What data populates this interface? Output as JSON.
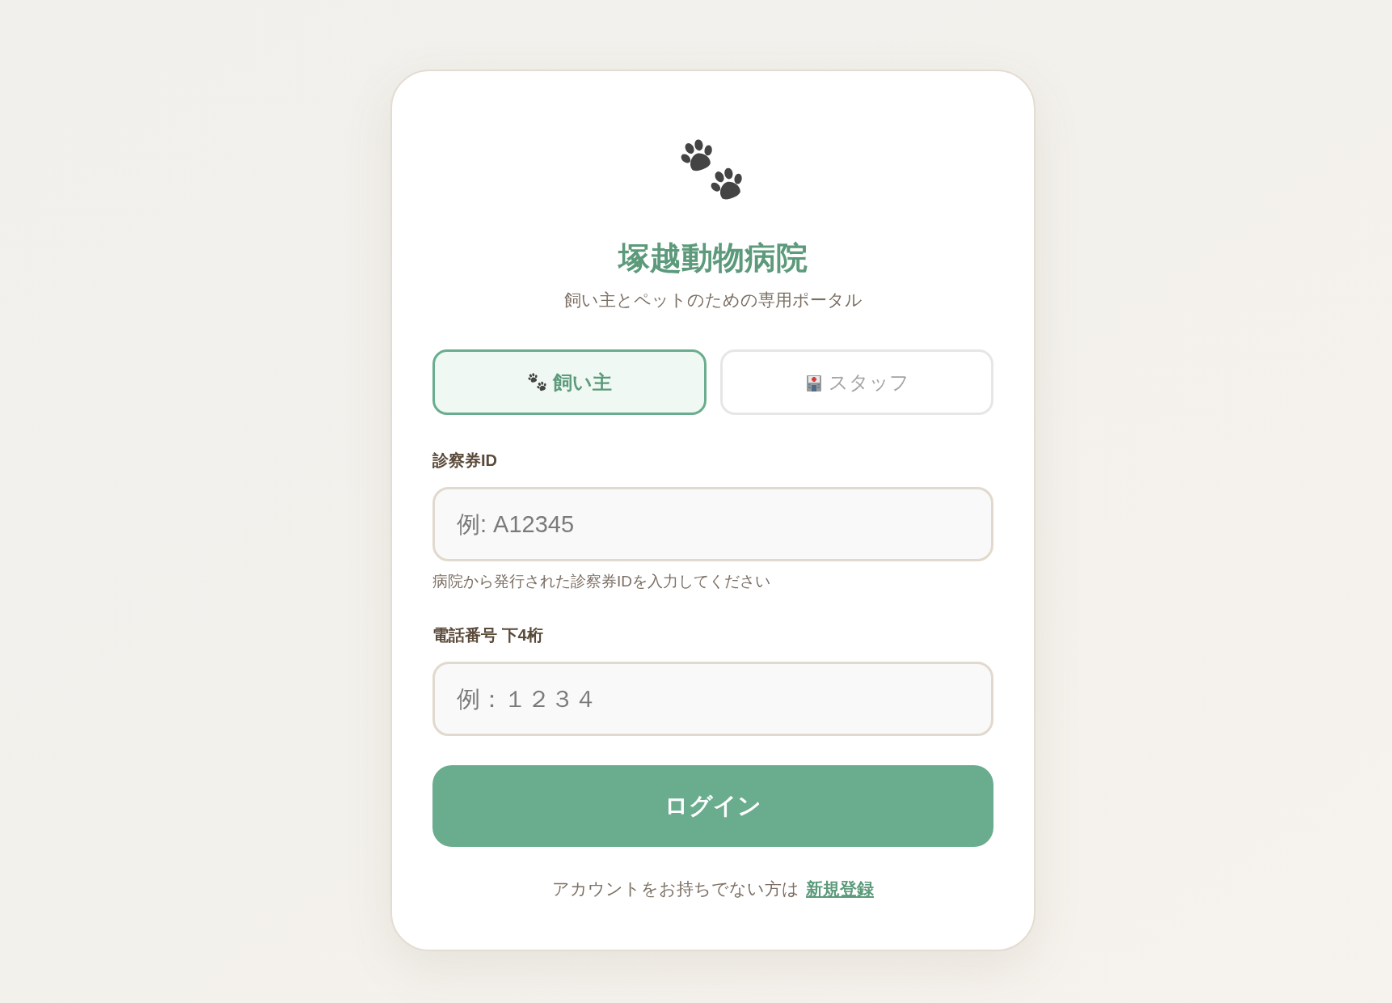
{
  "header": {
    "title": "塚越動物病院",
    "subtitle": "飼い主とペットのための専用ポータル"
  },
  "role_tabs": [
    {
      "kind": "owner",
      "label": "飼い主",
      "selected": true
    },
    {
      "kind": "staff",
      "label": "スタッフ",
      "selected": false
    }
  ],
  "fields": [
    {
      "label": "診察券ID",
      "placeholder": "例: A12345",
      "hint": "病院から発行された診察券IDを入力してください"
    },
    {
      "label": "電話番号 下4桁",
      "placeholder": "例：１２３４"
    }
  ],
  "login_button": {
    "label": "ログイン"
  },
  "footer": {
    "text": "アカウントをお持ちでない方は",
    "link": "新規登録"
  }
}
